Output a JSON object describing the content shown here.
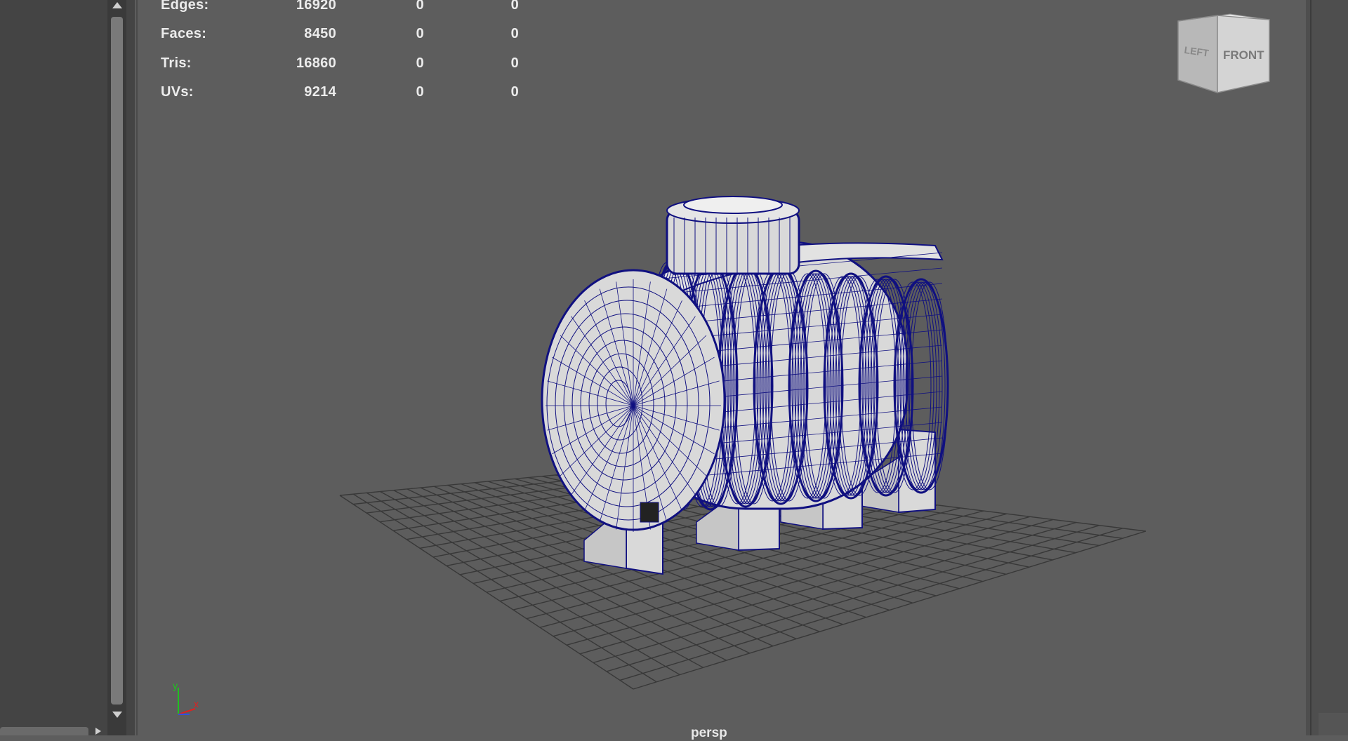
{
  "hud": {
    "rows": [
      {
        "label": "Edges:",
        "total": "16920",
        "selected": "0",
        "tri": "0"
      },
      {
        "label": "Faces:",
        "total": "8450",
        "selected": "0",
        "tri": "0"
      },
      {
        "label": "Tris:",
        "total": "16860",
        "selected": "0",
        "tri": "0"
      },
      {
        "label": "UVs:",
        "total": "9214",
        "selected": "0",
        "tri": "0"
      }
    ]
  },
  "viewcube": {
    "left_label": "LEFT",
    "front_label": "FRONT"
  },
  "axis": {
    "y": "y",
    "x": "x"
  },
  "camera_label": "persp",
  "colors": {
    "background": "#5d5d5d",
    "wireframe": "#101080",
    "mesh_fill": "#d9d9d9",
    "grid": "#383838",
    "axis_x": "#e02020",
    "axis_y": "#20c020",
    "axis_z": "#3050e0"
  },
  "icons": [
    "scroll-up-arrow-icon",
    "scroll-down-arrow-icon",
    "splitter-arrow-icon",
    "view-cube-icon",
    "axis-gizmo-icon"
  ]
}
